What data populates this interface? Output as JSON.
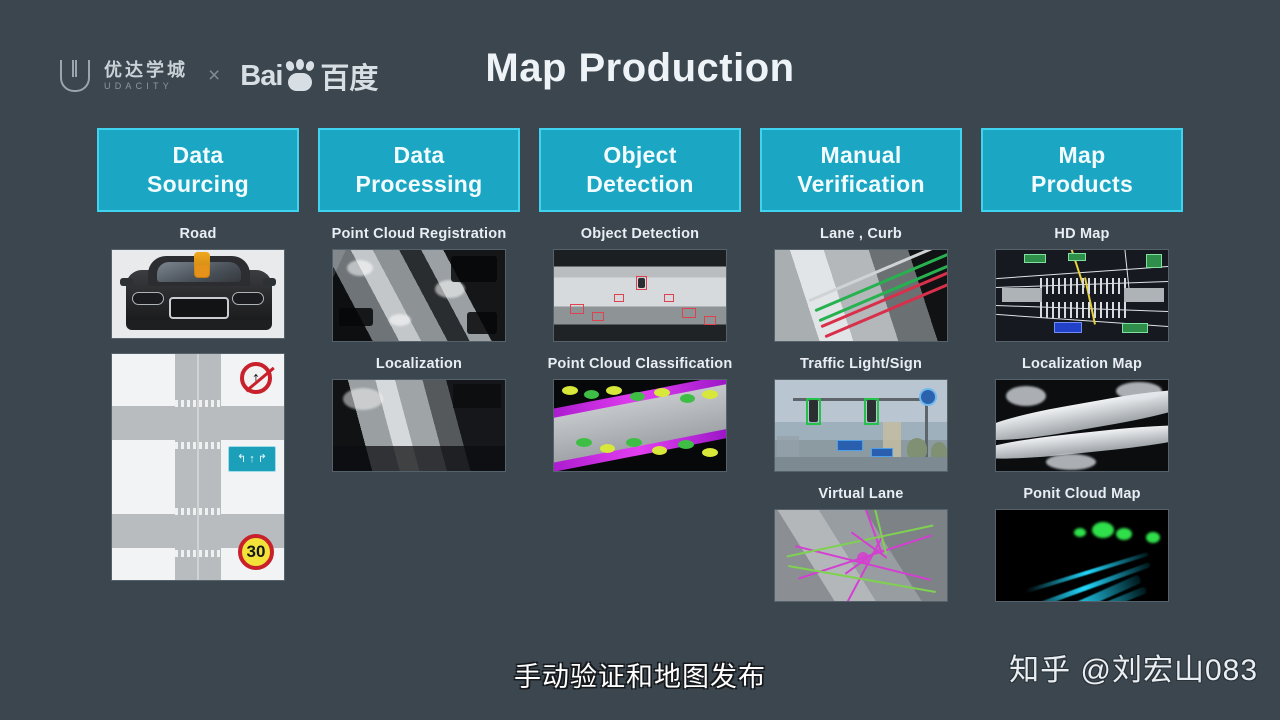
{
  "brand": {
    "udacity_cn": "优达学城",
    "udacity_en": "UDACITY",
    "separator": "×",
    "baidu_latin": "Bai",
    "baidu_cn": "百度",
    "logo_color": "#9aa5ad"
  },
  "title": "Map Production",
  "theme": {
    "background": "#3c464f",
    "header_fill": "#1ba7c4",
    "header_border": "#3fd3ef",
    "text": "#e8eef3"
  },
  "columns": [
    {
      "header": "Data\nSourcing",
      "header_line1": "Data",
      "header_line2": "Sourcing",
      "items": [
        {
          "label": "Road",
          "art": "car-photo"
        },
        {
          "label": "",
          "art": "intersection-diagram"
        }
      ]
    },
    {
      "header_line1": "Data",
      "header_line2": "Processing",
      "items": [
        {
          "label": "Point Cloud Registration",
          "art": "grayscale-point-cloud-aerial"
        },
        {
          "label": "Localization",
          "art": "grayscale-point-cloud-road"
        }
      ]
    },
    {
      "header_line1": "Object",
      "header_line2": "Detection",
      "items": [
        {
          "label": "Object Detection",
          "art": "object-detection-boxes"
        },
        {
          "label": "Point Cloud Classification",
          "art": "point-cloud-classification"
        }
      ]
    },
    {
      "header_line1": "Manual",
      "header_line2": "Verification",
      "items": [
        {
          "label": "Lane , Curb",
          "art": "lane-curb-point-cloud"
        },
        {
          "label": "Traffic Light/Sign",
          "art": "traffic-light-photo"
        },
        {
          "label": "Virtual Lane",
          "art": "virtual-lane-overlay"
        }
      ]
    },
    {
      "header_line1": "Map",
      "header_line2": "Products",
      "items": [
        {
          "label": "HD Map",
          "art": "hd-map"
        },
        {
          "label": "Localization Map",
          "art": "localization-map"
        },
        {
          "label": "Ponit Cloud Map",
          "art": "point-cloud-map"
        }
      ]
    }
  ],
  "road_diagram": {
    "sign_no_straight": "↑",
    "sign_lane": [
      "↰",
      "↑",
      "↱"
    ],
    "sign_speed_limit": "30"
  },
  "subtitle": "手动验证和地图发布",
  "watermark": "知乎 @刘宏山083"
}
